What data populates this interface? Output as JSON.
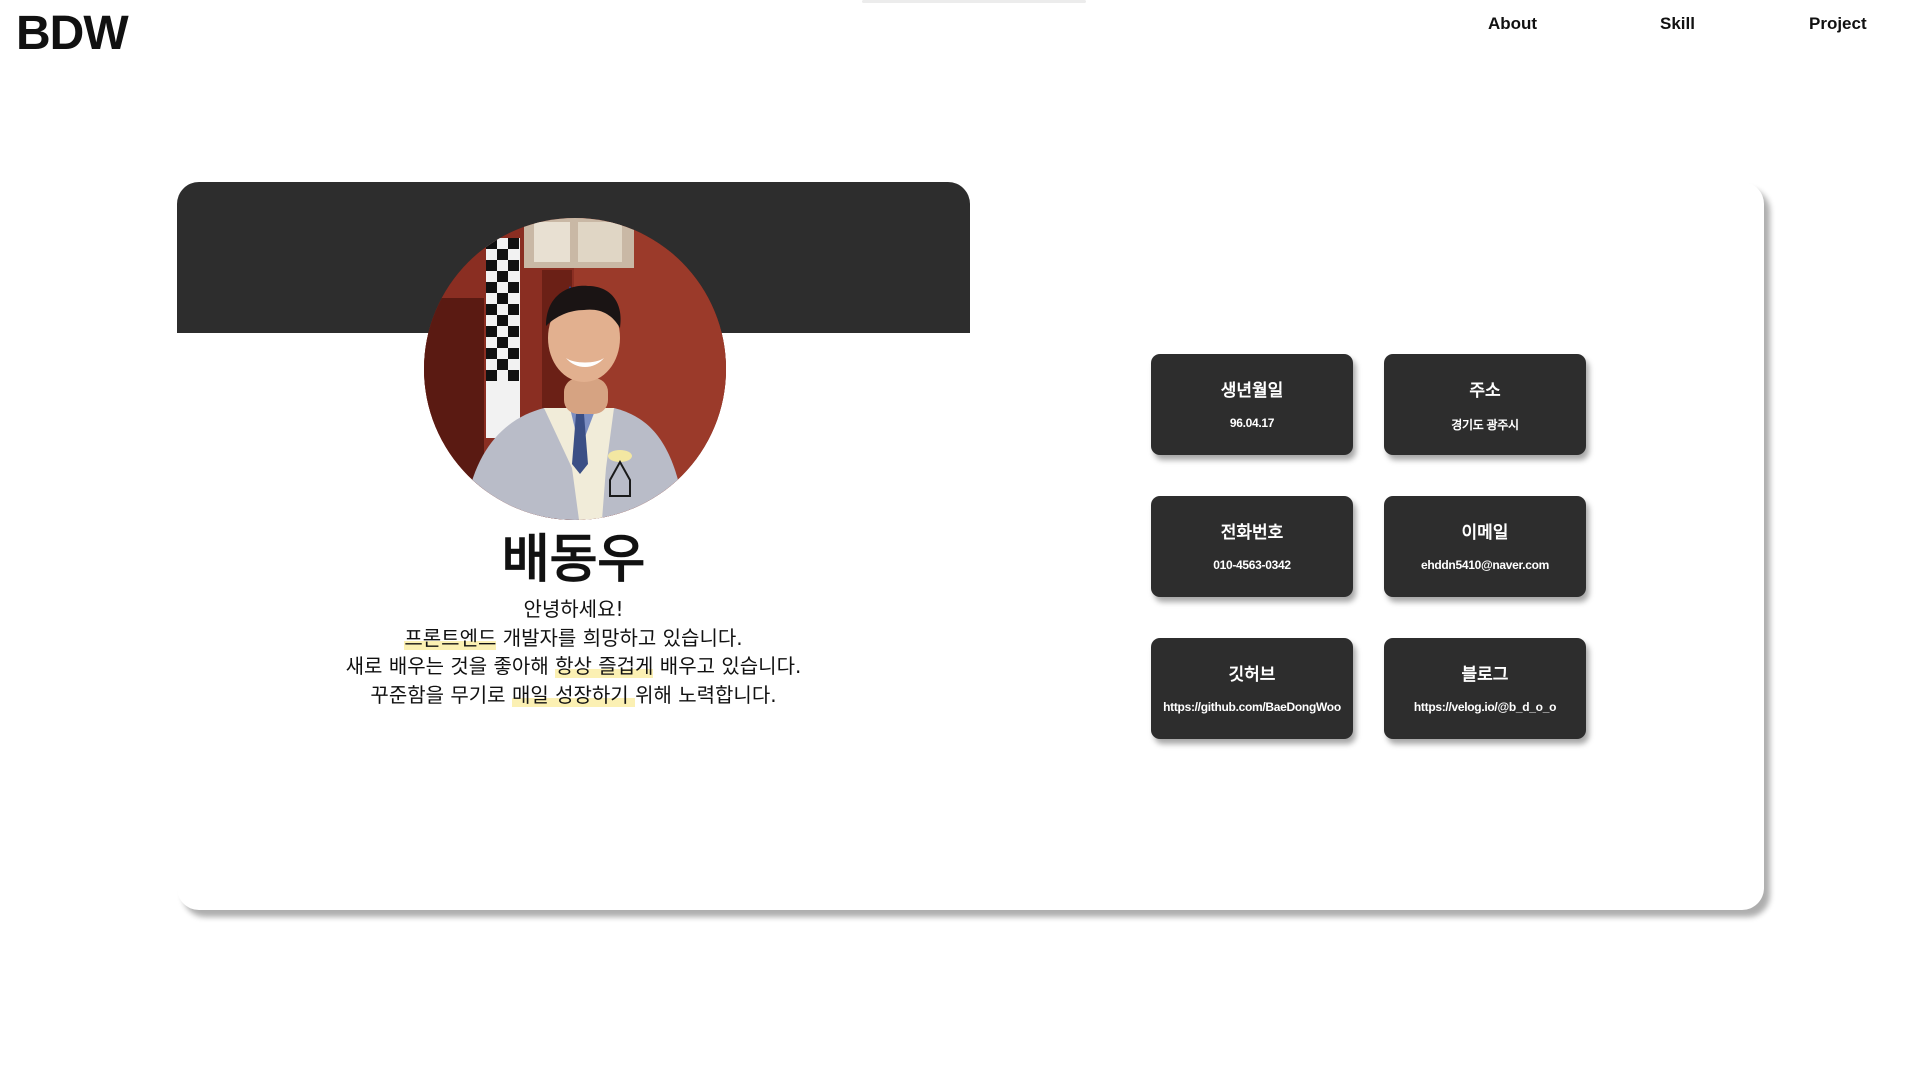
{
  "header": {
    "logo": "BDW",
    "nav": [
      {
        "label": "About"
      },
      {
        "label": "Skill"
      },
      {
        "label": "Project"
      }
    ]
  },
  "profile": {
    "name": "배동우",
    "intro_lines": [
      [
        "안녕하세요!"
      ],
      [
        "프론트엔드",
        " 개발자를 희망하고 있습니다."
      ],
      [
        "새로 배우는 것을 좋아해 ",
        "항상 즐겁게",
        " 배우고 있습니다."
      ],
      [
        "꾸준함을 무기로 ",
        "매일 성장하기 ",
        "위해 노력합니다."
      ]
    ]
  },
  "info": [
    {
      "label": "생년월일",
      "value": "96.04.17"
    },
    {
      "label": "주소",
      "value": "경기도 광주시"
    },
    {
      "label": "전화번호",
      "value": "010-4563-0342"
    },
    {
      "label": "이메일",
      "value": "ehddn5410@naver.com"
    },
    {
      "label": "깃허브",
      "value": "https://github.com/BaeDongWoo"
    },
    {
      "label": "블로그",
      "value": "https://velog.io/@b_d_o_o"
    }
  ],
  "colors": {
    "card_dark": "#2d2d2d",
    "highlight": "#fbf0b3",
    "text": "#111111"
  }
}
